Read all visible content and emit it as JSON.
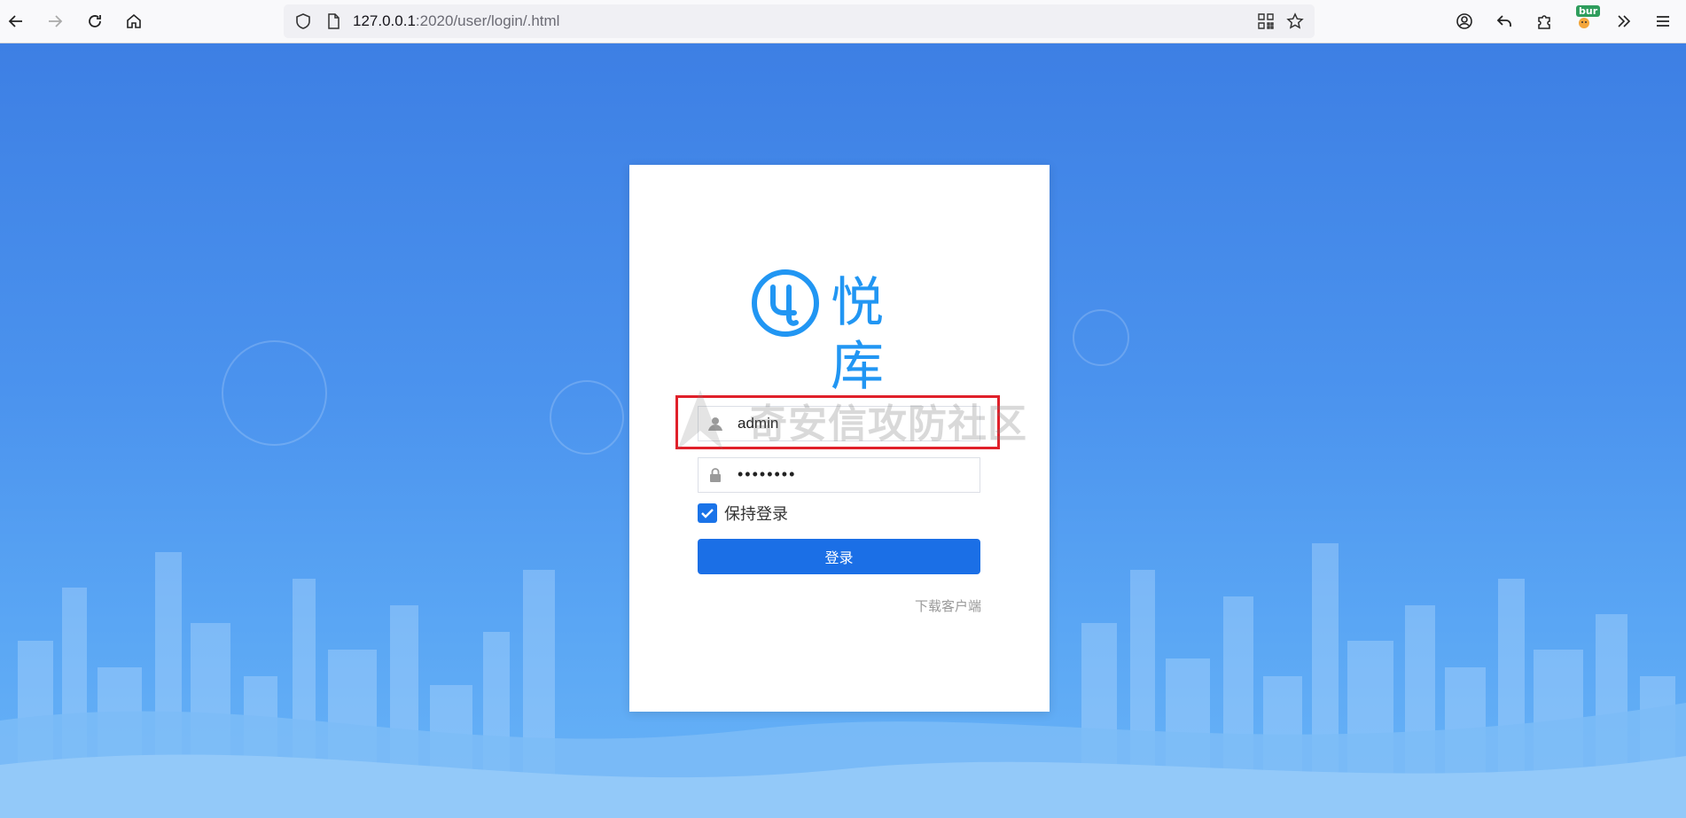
{
  "browser": {
    "url_host": "127.0.0.1",
    "url_rest": ":2020/user/login/.html",
    "extension_badge": "bur"
  },
  "login": {
    "logo_text": "悦库",
    "username_value": "admin",
    "password_value": "••••••••",
    "remember_label": "保持登录",
    "remember_checked": true,
    "submit_label": "登录",
    "download_link": "下载客户端"
  },
  "watermark": {
    "text": "奇安信攻防社区"
  },
  "colors": {
    "accent": "#1b6fe6",
    "logo": "#2196f3",
    "highlight": "#e0202a"
  }
}
